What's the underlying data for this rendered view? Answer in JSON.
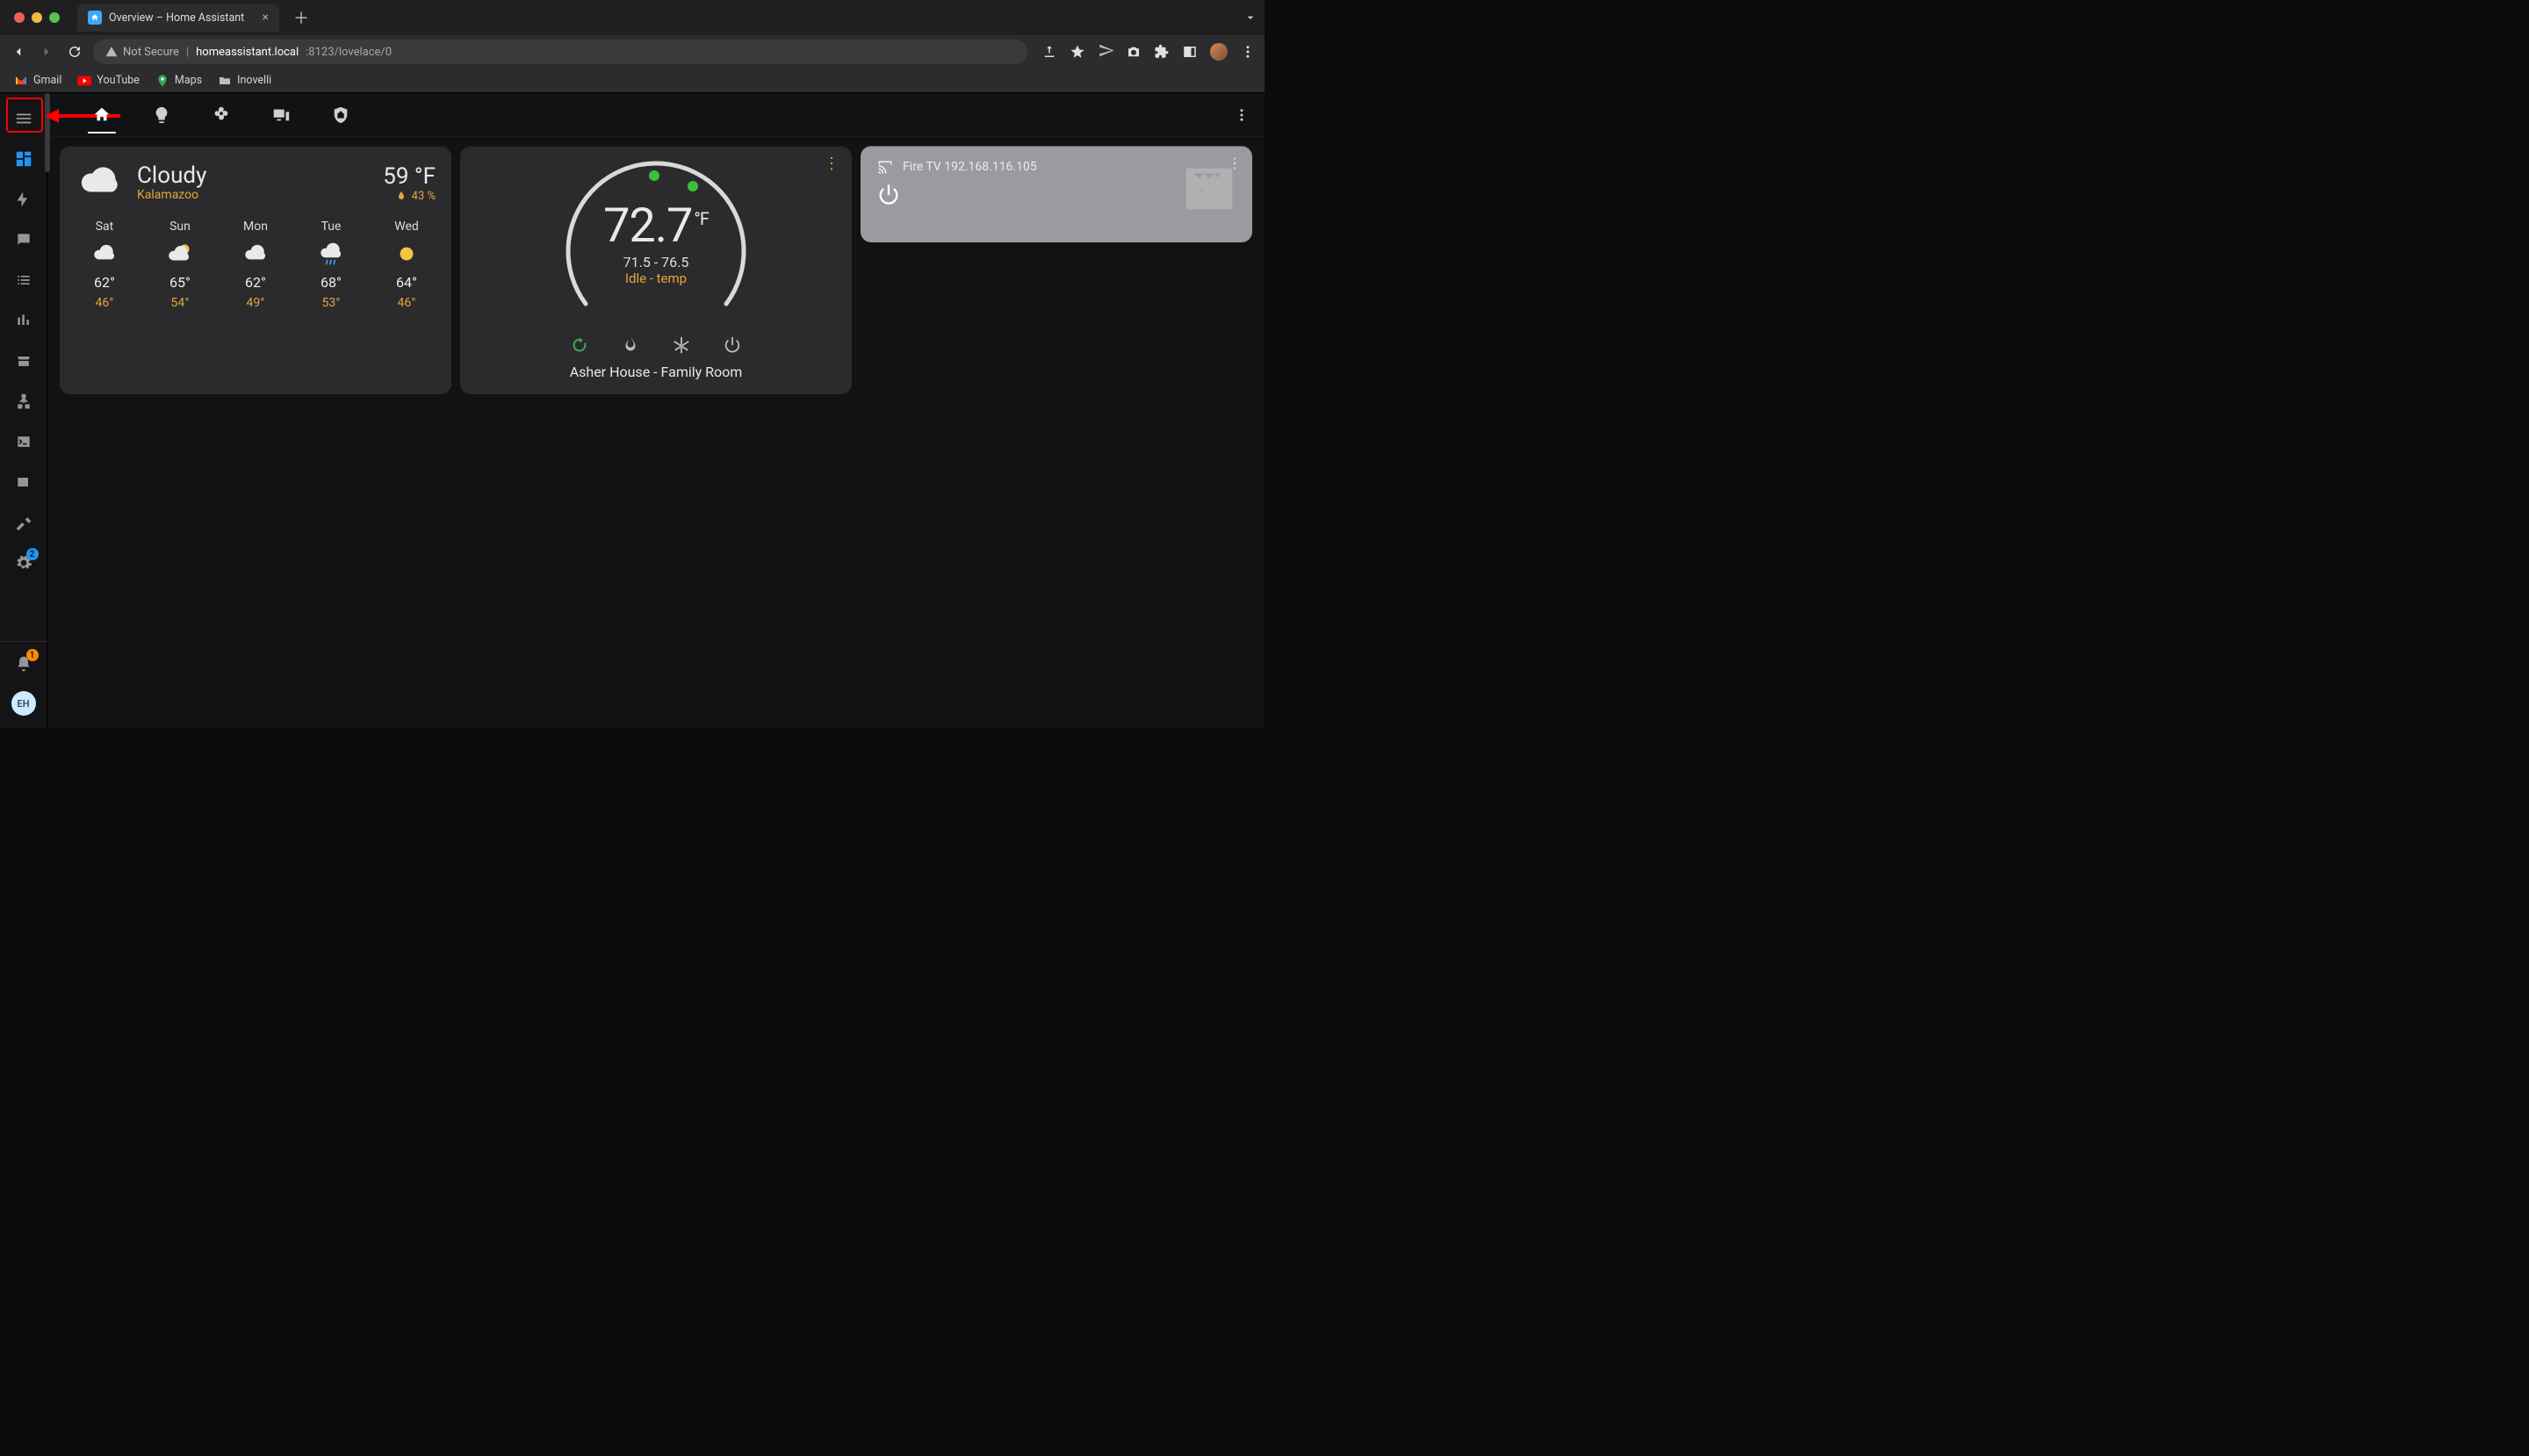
{
  "browser": {
    "tab_title": "Overview – Home Assistant",
    "address": {
      "not_secure": "Not Secure",
      "host": "homeassistant.local",
      "port_path": ":8123/lovelace/0"
    },
    "bookmarks": [
      {
        "label": "Gmail"
      },
      {
        "label": "YouTube"
      },
      {
        "label": "Maps"
      },
      {
        "label": "Inovelli"
      }
    ]
  },
  "sidebar": {
    "settings_badge": "2",
    "notifications_badge": "1",
    "profile_initials": "EH"
  },
  "weather": {
    "condition": "Cloudy",
    "location": "Kalamazoo",
    "temp": "59 °F",
    "humidity": "43 %",
    "forecast": [
      {
        "day": "Sat",
        "icon": "cloudy",
        "hi": "62°",
        "lo": "46°"
      },
      {
        "day": "Sun",
        "icon": "partly-sunny",
        "hi": "65°",
        "lo": "54°"
      },
      {
        "day": "Mon",
        "icon": "cloudy",
        "hi": "62°",
        "lo": "49°"
      },
      {
        "day": "Tue",
        "icon": "rainy",
        "hi": "68°",
        "lo": "53°"
      },
      {
        "day": "Wed",
        "icon": "sunny",
        "hi": "64°",
        "lo": "46°"
      }
    ]
  },
  "thermostat": {
    "temp": "72.7",
    "unit": "°F",
    "range": "71.5 - 76.5",
    "status": "Idle - temp",
    "name": "Asher House - Family Room"
  },
  "media": {
    "title": "Fire TV 192.168.116.105"
  }
}
